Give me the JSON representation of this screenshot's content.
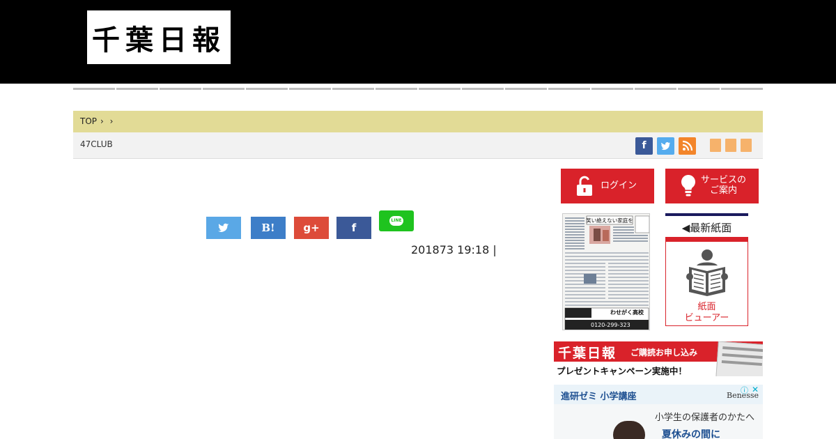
{
  "header": {
    "logo_text": "千葉日報"
  },
  "nav": {
    "item_count": 16
  },
  "breadcrumb": {
    "top": "TOP",
    "sep1": "›",
    "sep2": "›"
  },
  "subbar": {
    "club": "47CLUB"
  },
  "social": {
    "fb": "f",
    "tw": "t",
    "rss": "rss"
  },
  "share": {
    "twitter": "t",
    "hatena": "B!",
    "gplus": "g+",
    "facebook": "f",
    "line": "LINE"
  },
  "article": {
    "date": "201873 19:18 |"
  },
  "sidebar": {
    "login": "ログイン",
    "service_line1": "サービスの",
    "service_line2": "ご案内",
    "latest_paper": "◀最新紙面",
    "viewer_line1": "紙面",
    "viewer_line2": "ビューアー",
    "paper_headline": "笑い絶えない家庭を",
    "paper_ad": "わせがく高校",
    "paper_tel": "0120-299-323"
  },
  "banners": {
    "b1_logo": "千葉日報",
    "b1_tag": "ご購読お申し込み",
    "b1_campaign": "プレゼントキャンペーン実施中！",
    "b2_title": "進研ゼミ 小学講座",
    "b2_brand": "Benesse",
    "b2_line1": "小学生の保護者のかたへ",
    "b2_line2": "夏休みの間に"
  },
  "colors": {
    "header_bg": "#000000",
    "breadcrumb_bg": "#e2db96",
    "accent_red": "#d9222a",
    "facebook": "#3b5998",
    "twitter": "#55acee",
    "rss": "#f3852a",
    "line": "#1fc31f"
  }
}
